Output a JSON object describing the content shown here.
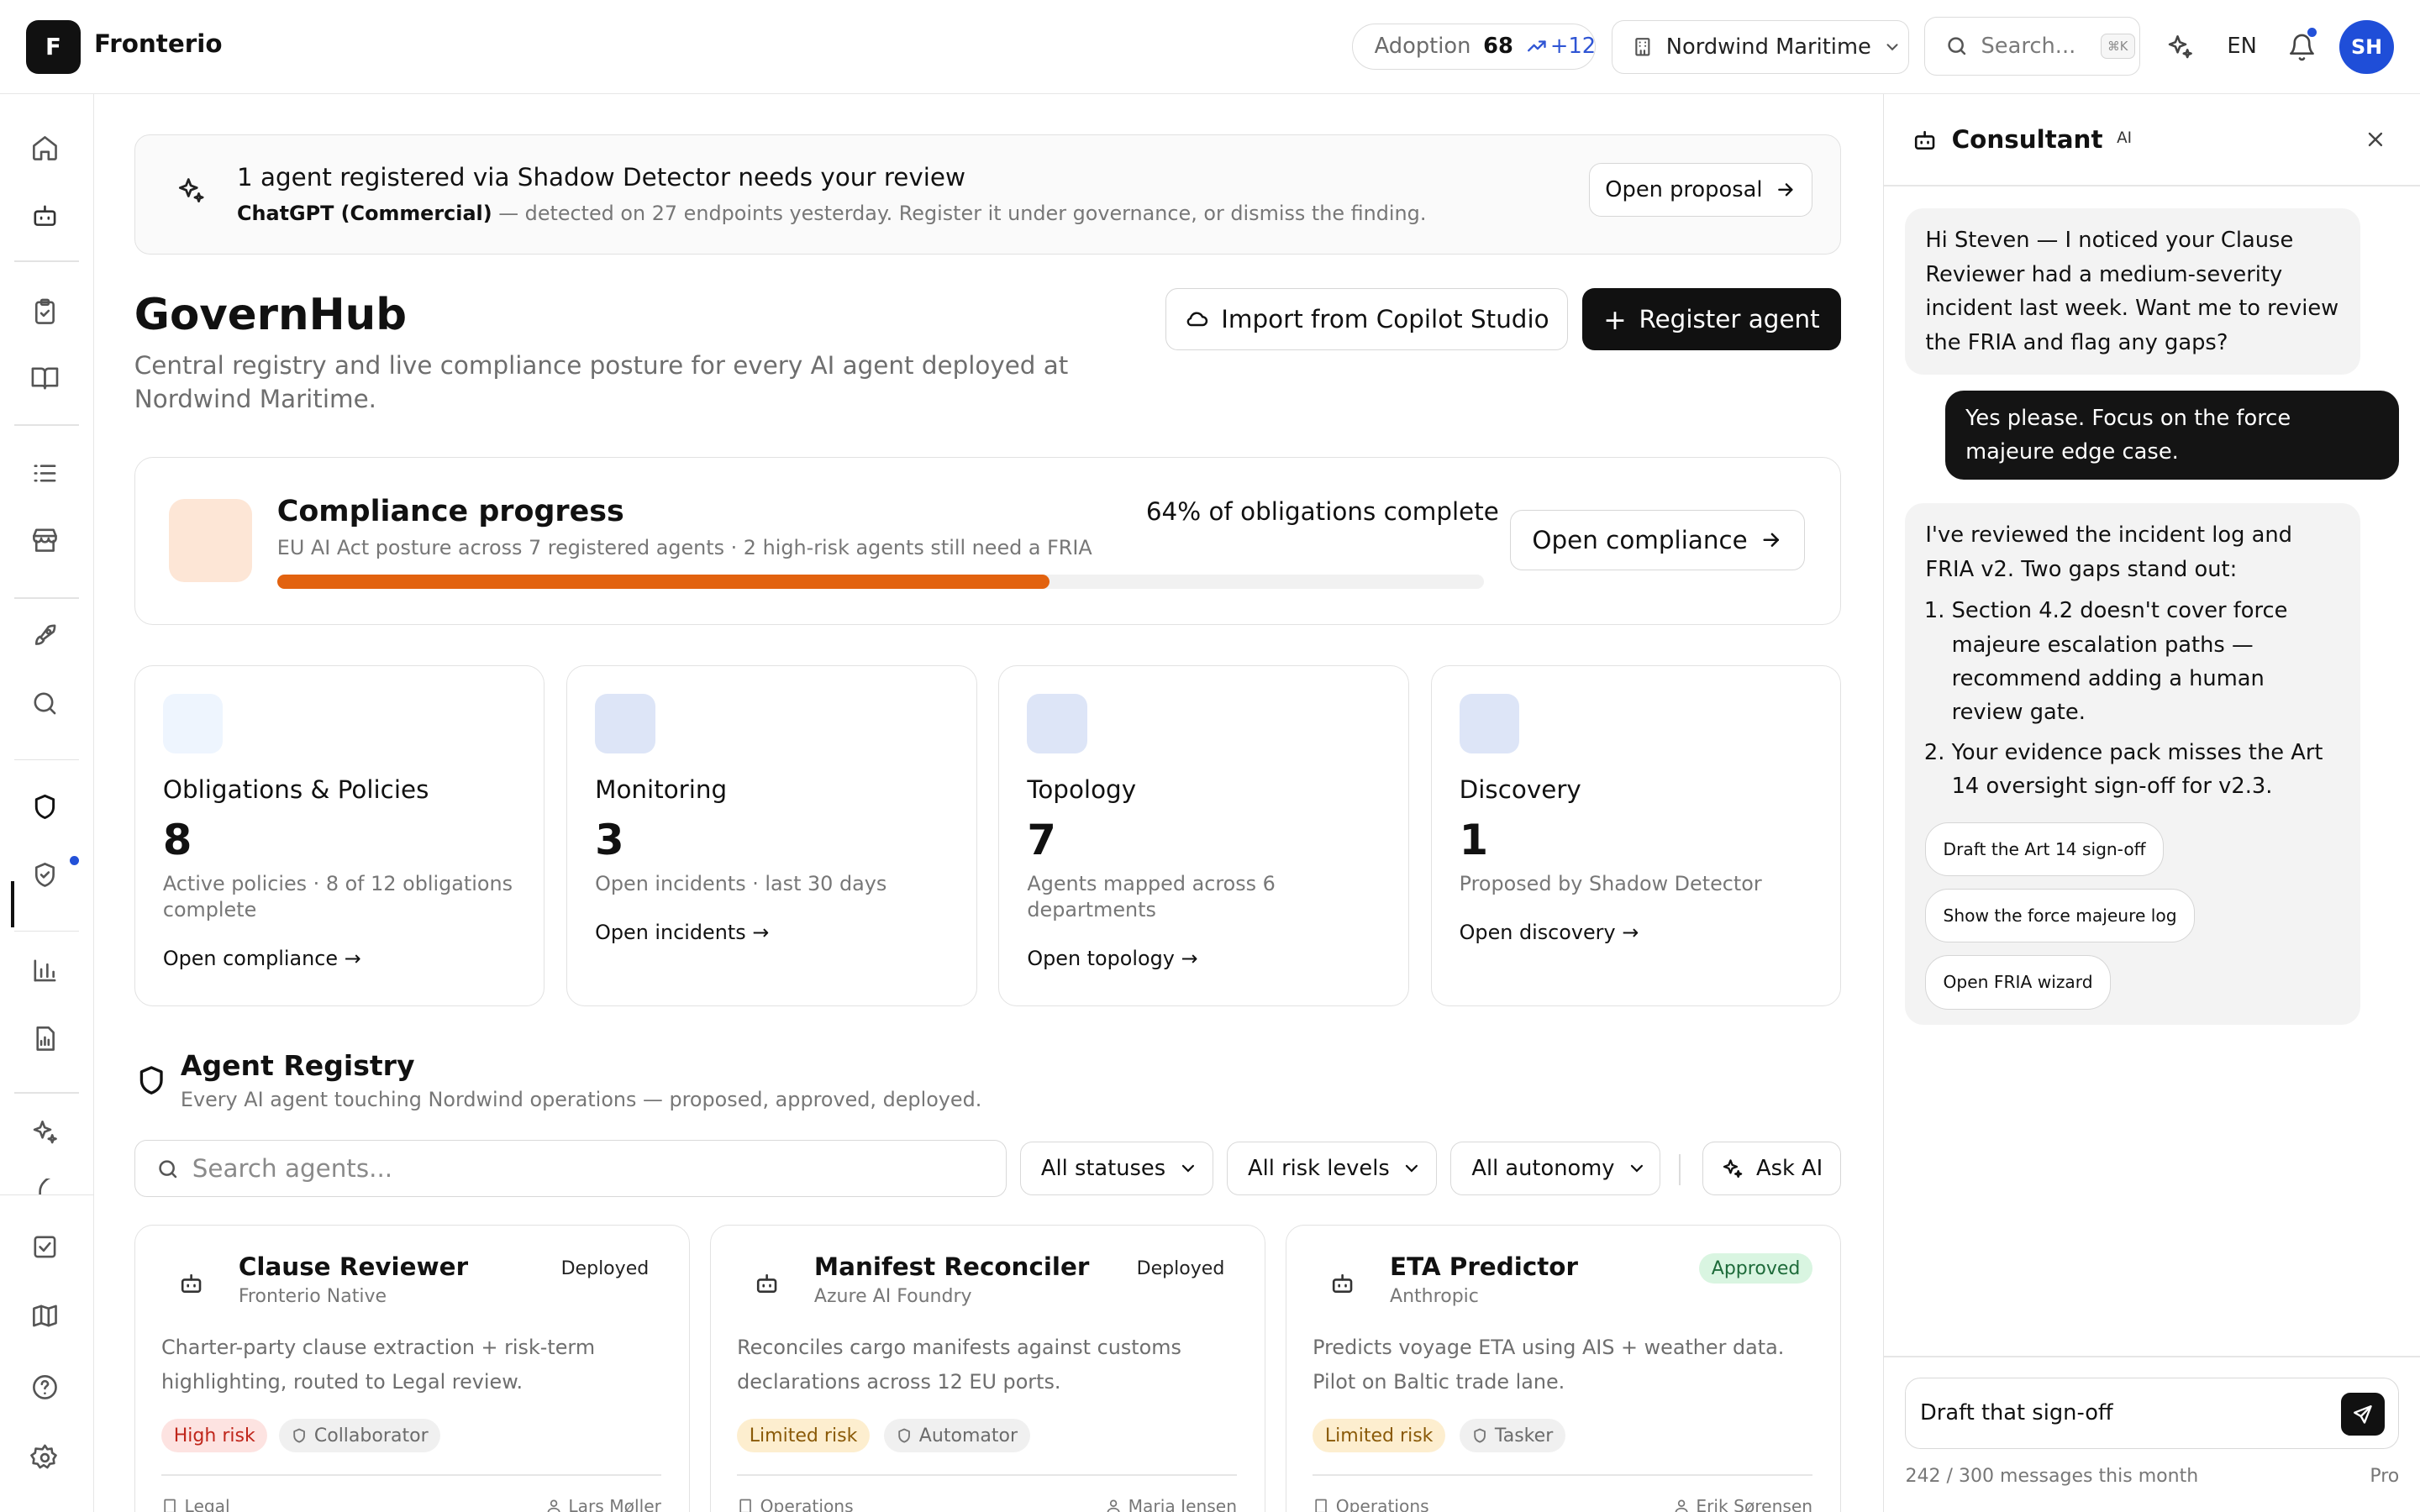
{
  "topbar": {
    "logo_letter": "F",
    "brand": "Fronterio",
    "adoption": {
      "label": "Adoption",
      "value": "68",
      "delta": "+12"
    },
    "workspace": "Nordwind Maritime",
    "search": {
      "placeholder": "Search...",
      "shortcut": "⌘K"
    },
    "language": "EN",
    "user_initials": "SH"
  },
  "rail": {
    "icons": [
      "home-icon",
      "bot-icon",
      "clipboard-icon",
      "book-icon",
      "list-icon",
      "store-icon",
      "rocket-icon",
      "search-icon",
      "shield-icon",
      "shield-check-icon",
      "bar-chart-icon",
      "report-icon",
      "sparkles-icon",
      "feather-icon",
      "check-square-icon",
      "map-icon",
      "help-icon",
      "settings-icon"
    ],
    "active": "shield-icon"
  },
  "banner": {
    "title": "1 agent registered via Shadow Detector needs your review",
    "sub_bold": "ChatGPT (Commercial)",
    "sub_rest": " — detected on 27 endpoints yesterday. Register it under governance, or dismiss the finding.",
    "button": "Open proposal"
  },
  "header": {
    "title": "GovernHub",
    "subtitle": "Central registry and live compliance posture for every AI agent deployed at Nordwind Maritime.",
    "import_button": "Import from Copilot Studio",
    "register_button": "Register agent"
  },
  "compliance": {
    "title": "Compliance progress",
    "subtitle": "EU AI Act posture across 7 registered agents · 2 high-risk agents still need a FRIA",
    "percent_label": "64% of obligations complete",
    "progress": 0.64,
    "button": "Open compliance",
    "swatch_color": "#fde6d6",
    "bar_color": "#e2620f"
  },
  "stats": [
    {
      "label": "Obligations & Policies",
      "value": "8",
      "desc": "Active policies · 8 of 12 obligations complete",
      "link": "Open compliance →",
      "color": "#eef5fe"
    },
    {
      "label": "Monitoring",
      "value": "3",
      "desc": "Open incidents · last 30 days",
      "link": "Open incidents →",
      "color": "#dde5f7"
    },
    {
      "label": "Topology",
      "value": "7",
      "desc": "Agents mapped across 6 departments",
      "link": "Open topology →",
      "color": "#dde5f7"
    },
    {
      "label": "Discovery",
      "value": "1",
      "desc": "Proposed by Shadow Detector",
      "link": "Open discovery →",
      "color": "#dde5f7"
    }
  ],
  "registry": {
    "title": "Agent Registry",
    "subtitle": "Every AI agent touching Nordwind operations — proposed, approved, deployed.",
    "search_placeholder": "Search agents...",
    "filters": [
      "All statuses",
      "All risk levels",
      "All autonomy"
    ],
    "ask_ai": "Ask AI",
    "agents": [
      {
        "name": "Clause Reviewer",
        "vendor": "Fronterio Native",
        "status": "Deployed",
        "desc": "Charter-party clause extraction + risk-term highlighting, routed to Legal review.",
        "risk": "High risk",
        "role": "Collaborator",
        "department": "Legal",
        "owner": "Lars Møller"
      },
      {
        "name": "Manifest Reconciler",
        "vendor": "Azure AI Foundry",
        "status": "Deployed",
        "desc": "Reconciles cargo manifests against customs declarations across 12 EU ports.",
        "risk": "Limited risk",
        "role": "Automator",
        "department": "Operations",
        "owner": "Maria Jensen"
      },
      {
        "name": "ETA Predictor",
        "vendor": "Anthropic",
        "status": "Approved",
        "desc": "Predicts voyage ETA using AIS + weather data. Pilot on Baltic trade lane.",
        "risk": "Limited risk",
        "role": "Tasker",
        "department": "Operations",
        "owner": "Erik Sørensen"
      }
    ]
  },
  "consultant": {
    "title": "Consultant",
    "badge": "AI",
    "msg1": "Hi Steven — I noticed your Clause Reviewer had a medium-severity incident last week. Want me to review the FRIA and flag any gaps?",
    "user_msg": "Yes please. Focus on the force majeure edge case.",
    "msg2_intro": "I've reviewed the incident log and FRIA v2. Two gaps stand out:",
    "msg2_points": [
      "Section 4.2 doesn't cover force majeure escalation paths — recommend adding a human review gate.",
      "Your evidence pack misses the Art 14 oversight sign-off for v2.3."
    ],
    "chips": [
      "Draft the Art 14 sign-off",
      "Show the force majeure log",
      "Open FRIA wizard"
    ],
    "input_value": "Draft that sign-off",
    "quota": "242 / 300 messages this month",
    "plan": "Pro"
  }
}
